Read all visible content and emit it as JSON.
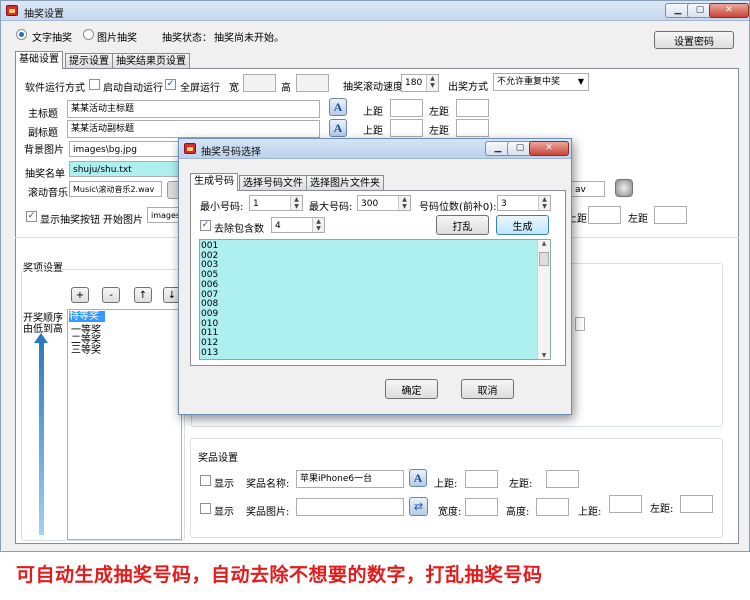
{
  "window": {
    "title": "抽奖设置"
  },
  "mode": {
    "text_label": "文字抽奖",
    "image_label": "图片抽奖",
    "selected": "text"
  },
  "status": {
    "label": "抽奖状态：",
    "value": "抽奖尚未开始。"
  },
  "set_password_label": "设置密码",
  "tabs": [
    "基础设置",
    "提示设置",
    "抽奖结果页设置"
  ],
  "basic": {
    "run_mode_label": "软件运行方式",
    "autostart_label": "启动自动运行",
    "autostart_checked": false,
    "fullscreen_label": "全屏运行",
    "fullscreen_checked": true,
    "width_label": "宽",
    "height_label": "高",
    "scroll_speed_label": "抽奖滚动速度",
    "scroll_speed_value": "180",
    "draw_mode_label": "出奖方式",
    "draw_mode_value": "不允许重复中奖",
    "main_title_label": "主标题",
    "main_title_value": "某某活动主标题",
    "sub_title_label": "副标题",
    "sub_title_value": "某某活动副标题",
    "bg_image_label": "背景图片",
    "bg_image_value": "images\\bg.jpg",
    "name_list_label": "抽奖名单",
    "name_list_value": "shuju/shu.txt",
    "music_label": "滚动音乐",
    "music_value": "Music\\滚动音乐2.wav",
    "music_value_right": "av",
    "show_button_label": "显示抽奖按钮",
    "show_button_checked": true,
    "start_image_label": "开始图片",
    "start_image_value": "images\\",
    "top_margin_label": "上距",
    "left_margin_label": "左距"
  },
  "prizes": {
    "section_label": "奖项设置",
    "order_label_1": "开奖顺序",
    "order_label_2": "由低到高",
    "buttons": [
      "+",
      "-",
      "↑",
      "↓"
    ],
    "items": [
      "特等奖",
      "一等奖",
      "二等奖",
      "三等奖"
    ]
  },
  "prize_settings": {
    "section_label": "奖品设置",
    "show_label": "显示",
    "name_label": "奖品名称:",
    "name_value": "苹果iPhone6一台",
    "top_label": "上距:",
    "left_label": "左距:",
    "image_label": "奖品图片:",
    "width_label": "宽度:",
    "height_label": "高度:"
  },
  "dialog": {
    "title": "抽奖号码选择",
    "tabs": [
      "生成号码",
      "选择号码文件",
      "选择图片文件夹"
    ],
    "min_label": "最小号码:",
    "min_value": "1",
    "max_label": "最大号码:",
    "max_value": "300",
    "digits_label": "号码位数(前补0):",
    "digits_value": "3",
    "exclude_label": "去除包含数",
    "exclude_checked": true,
    "exclude_value": "4",
    "shuffle_label": "打乱",
    "generate_label": "生成",
    "numbers": [
      "001",
      "002",
      "003",
      "005",
      "006",
      "007",
      "008",
      "009",
      "010",
      "011",
      "012",
      "013"
    ],
    "ok_label": "确定",
    "cancel_label": "取消"
  },
  "caption": "可自动生成抽奖号码，自动去除不想要的数字，打乱抽奖号码",
  "colors": {
    "caption": "#e31b1b",
    "listbox": "#aeeff0",
    "arrow": "#2b7ac0"
  }
}
